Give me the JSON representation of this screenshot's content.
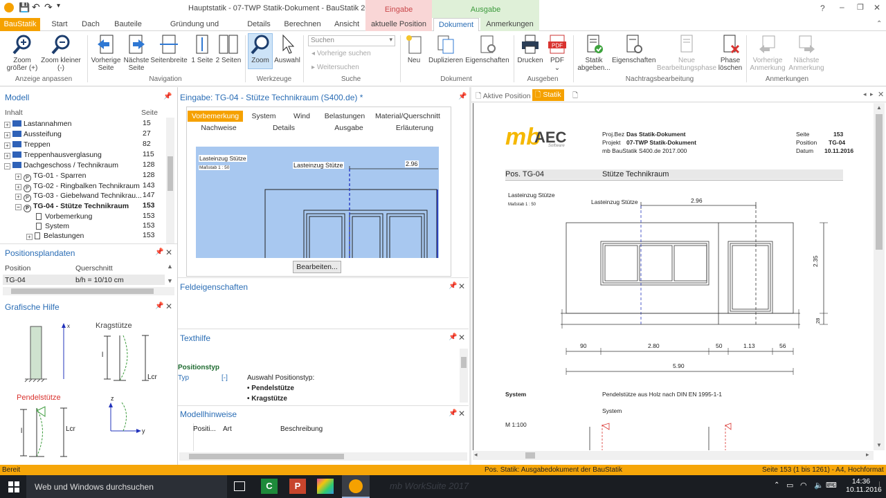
{
  "titlebar": {
    "title": "Hauptstatik - 07-TWP Statik-Dokument - BauStatik 2017",
    "context_eingabe": "Eingabe",
    "context_ausgabe": "Ausgabe",
    "win_buttons": [
      "?",
      "–",
      "❐",
      "✕"
    ]
  },
  "tabs": [
    "BauStatik",
    "Start",
    "Dach",
    "Bauteile",
    "Gründung und Grundbau",
    "Details",
    "Berechnen",
    "Ansicht",
    "aktuelle Position",
    "Dokument",
    "Anmerkungen"
  ],
  "ribbon": {
    "buttons": [
      {
        "label": "Zoom\ngrößer (+)"
      },
      {
        "label": "Zoom kleiner\n(-)"
      },
      {
        "label": "Vorherige\nSeite"
      },
      {
        "label": "Nächste\nSeite"
      },
      {
        "label": "Seitenbreite"
      },
      {
        "label": "1 Seite"
      },
      {
        "label": "2 Seiten"
      },
      {
        "label": "Zoom"
      },
      {
        "label": "Auswahl"
      },
      {
        "label": "Neu"
      },
      {
        "label": "Duplizieren"
      },
      {
        "label": "Eigenschaften"
      },
      {
        "label": "Drucken"
      },
      {
        "label": "PDF\n⌄"
      },
      {
        "label": "Statik\nabgeben..."
      },
      {
        "label": "Eigenschaften"
      },
      {
        "label": "Neue\nBearbeitungsphase"
      },
      {
        "label": "Phase\nlöschen"
      },
      {
        "label": "Vorherige\nAnmerkung"
      },
      {
        "label": "Nächste\nAnmerkung"
      }
    ],
    "search_placeholder": "Suchen",
    "search_prev": "Vorherige suchen",
    "search_next": "Weitersuchen",
    "groups": [
      "Anzeige anpassen",
      "Navigation",
      "Werkzeuge",
      "Suche",
      "Dokument",
      "Ausgeben",
      "Nachtragsbearbeitung",
      "Anmerkungen"
    ]
  },
  "modell": {
    "title": "Modell",
    "col_inhalt": "Inhalt",
    "col_seite": "Seite",
    "rows": [
      {
        "label": "Lastannahmen",
        "page": "15"
      },
      {
        "label": "Aussteifung",
        "page": "27"
      },
      {
        "label": "Treppen",
        "page": "82"
      },
      {
        "label": "Treppenhausverglasung",
        "page": "115"
      },
      {
        "label": "Dachgeschoss / Technikraum",
        "page": "128"
      },
      {
        "label": "TG-01 - Sparren",
        "page": "128"
      },
      {
        "label": "TG-02 - Ringbalken Technikraum",
        "page": "143"
      },
      {
        "label": "TG-03 - Giebelwand Technikrau...",
        "page": "147"
      },
      {
        "label": "TG-04 - Stütze Technikraum",
        "page": "153"
      },
      {
        "label": "Vorbemerkung",
        "page": "153"
      },
      {
        "label": "System",
        "page": "153"
      },
      {
        "label": "Belastungen",
        "page": "153"
      }
    ]
  },
  "positionsplan": {
    "title": "Positionsplandaten",
    "col_position": "Position",
    "col_querschnitt": "Querschnitt",
    "row_position": "TG-04",
    "row_querschnitt": "b/h = 10/10 cm"
  },
  "grafische_hilfe": {
    "title": "Grafische Hilfe",
    "kragstuetze": "Kragstütze",
    "pendelstuetze": "Pendelstütze",
    "x": "x",
    "z": "z",
    "y": "y",
    "l": "l",
    "lcr": "Lcr"
  },
  "eingabe": {
    "title": "Eingabe: TG-04 - Stütze Technikraum (S400.de) *",
    "tabs_row1": [
      "Vorbemerkung",
      "System",
      "Wind",
      "Belastungen",
      "Material/Querschnitt"
    ],
    "tabs_row2": [
      "Nachweise",
      "Details",
      "Ausgabe",
      "Erläuterung"
    ],
    "drawing_title": "Lasteinzug Stütze",
    "drawing_scale": "Maßstab 1 : 50",
    "drawing_label": "Lasteinzug Stütze",
    "drawing_dim": "2.96",
    "edit_button": "Bearbeiten..."
  },
  "feldeigenschaften": {
    "title": "Feldeigenschaften"
  },
  "texthilfe": {
    "title": "Texthilfe",
    "heading": "Positionstyp",
    "typ_label": "Typ",
    "typ_marker": "[-]",
    "description": "Auswahl Positionstyp:",
    "opt1": "• Pendelstütze",
    "opt2": "• Kragstütze"
  },
  "modellhinweise": {
    "title": "Modellhinweise",
    "col_pos": "Positi...",
    "col_art": "Art",
    "col_beschreibung": "Beschreibung"
  },
  "document": {
    "tab_active": "Aktive Position",
    "tab_statik": "Statik",
    "logo_mb": "mb",
    "logo_aec": "AEC",
    "logo_sub": "Software",
    "hdr_projbez_label": "Proj.Bez",
    "hdr_projbez": "Das Statik-Dokument",
    "hdr_projekt_label": "Projekt",
    "hdr_projekt": "07-TWP Statik-Dokument",
    "hdr_software": "mb BauStatik S400.de 2017.000",
    "hdr_seite_label": "Seite",
    "hdr_seite": "153",
    "hdr_position_label": "Position",
    "hdr_position": "TG-04",
    "hdr_datum_label": "Datum",
    "hdr_datum": "10.11.2016",
    "pos": "Pos. TG-04",
    "pos_title": "Stütze Technikraum",
    "draw_title": "Lasteinzug Stütze",
    "draw_scale": "Maßstab 1 : 50",
    "draw_label": "Lasteinzug Stütze",
    "dim_top": "2.96",
    "dim_h1": "2.35",
    "dim_h2": "28",
    "dims": [
      "90",
      "2.80",
      "50",
      "1.13",
      "56"
    ],
    "dim_total": "5.90",
    "system_label": "System",
    "system_text": "Pendelstütze aus Holz nach DIN EN 1995-1-1",
    "system_sub": "System",
    "scale": "M 1:100"
  },
  "status": {
    "left": "Bereit",
    "mid": "Pos. Statik: Ausgabedokument der BauStatik",
    "right": "Seite 153 (1 bis 1261) - A4, Hochformat"
  },
  "taskbar": {
    "search": "Web und Windows durchsuchen",
    "faded": "mb WorkSuite 2017",
    "time": "14:36",
    "date": "10.11.2016"
  }
}
